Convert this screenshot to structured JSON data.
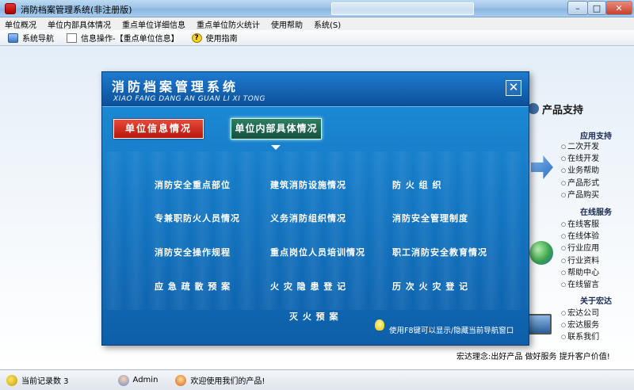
{
  "window": {
    "title": "消防档案管理系统(非注册版)",
    "controls": {
      "minimize": "–",
      "maximize": "□",
      "close": "✕"
    }
  },
  "menu": [
    "单位概况",
    "单位内部具体情况",
    "重点单位详细信息",
    "重点单位防火统计",
    "使用帮助",
    "系统(S)"
  ],
  "toolbar": {
    "nav": "系统导航",
    "info_op": "信息操作-【重点单位信息】",
    "guide": "使用指南"
  },
  "right_panel": {
    "title": "产品支持",
    "sections": [
      {
        "heading": "应用支持",
        "items": [
          "二次开发",
          "在线开发",
          "业务帮助",
          "产品形式",
          "产品购买"
        ]
      },
      {
        "heading": "在线服务",
        "items": [
          "在线客服",
          "在线体验",
          "行业应用",
          "行业资料",
          "帮助中心",
          "在线留言"
        ]
      },
      {
        "heading": "关于宏达",
        "items": [
          "宏达公司",
          "宏达服务",
          "联系我们"
        ]
      }
    ],
    "slogan": "宏达理念:出好产品 做好服务 提升客户价值!"
  },
  "dialog": {
    "title": "消防档案管理系统",
    "subtitle": "XIAO FANG DANG AN GUAN LI XI TONG",
    "close": "✕",
    "tab_unit_info": "单位信息情况",
    "tab_inner": "单位内部具体情况",
    "links": [
      "消防安全重点部位",
      "建筑消防设施情况",
      "防 火 组 织",
      "专兼职防火人员情况",
      "义务消防组织情况",
      "消防安全管理制度",
      "消防安全操作规程",
      "重点岗位人员培训情况",
      "职工消防安全教育情况",
      "应 急 疏 散 预 案",
      "火 灾 隐 患 登 记",
      "历 次 火 灾 登 记",
      "灭 火 预 案"
    ],
    "tip": "使用F8键可以显示/隐藏当前导航窗口"
  },
  "status": {
    "records": "当前记录数 3",
    "user": "Admin",
    "welcome": "欢迎使用我们的产品!"
  }
}
